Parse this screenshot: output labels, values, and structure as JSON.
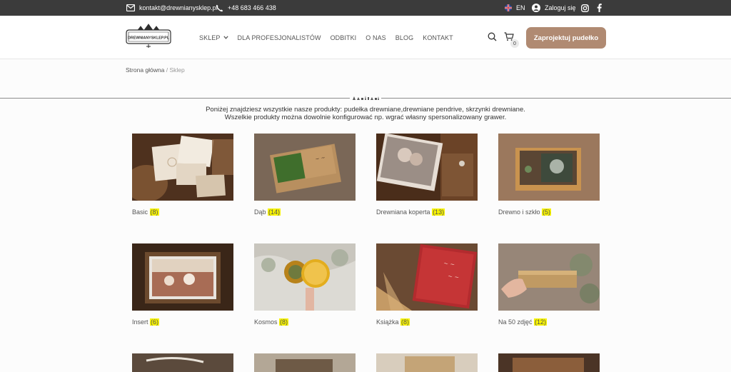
{
  "topbar": {
    "email": "kontakt@drewnianysklep.pl",
    "phone": "+48 683 466 438",
    "language": "EN",
    "login": "Zaloguj się"
  },
  "header": {
    "logo_text": "DREWNIANYSKLEP.PL",
    "nav": [
      {
        "label": "SKLEP",
        "has_dropdown": true
      },
      {
        "label": "DLA PROFESJONALISTÓW"
      },
      {
        "label": "ODBITKI"
      },
      {
        "label": "O NAS"
      },
      {
        "label": "BLOG"
      },
      {
        "label": "KONTAKT"
      }
    ],
    "cart_count": "0",
    "cta_label": "Zaprojektuj pudełko"
  },
  "breadcrumb": {
    "home": "Strona główna",
    "separator": " / ",
    "current": "Sklep"
  },
  "intro": {
    "line1": "Poniżej znajdziesz wszystkie nasze produkty: pudełka drewniane,drewniane pendrive, skrzynki drewniane.",
    "line2": "Wszelkie produkty można dowolnie konfigurować np. wgrać własny spersonalizowany grawer."
  },
  "categories": [
    {
      "name": "Basic",
      "count": "(8)"
    },
    {
      "name": "Dąb",
      "count": "(14)"
    },
    {
      "name": "Drewniana koperta",
      "count": "(13)"
    },
    {
      "name": "Drewno i szkło",
      "count": "(5)"
    },
    {
      "name": "Insert",
      "count": "(6)"
    },
    {
      "name": "Kosmos",
      "count": "(8)"
    },
    {
      "name": "Książka",
      "count": "(8)"
    },
    {
      "name": "Na 50 zdjęć",
      "count": "(12)"
    }
  ],
  "colors": {
    "topbar_bg": "#3b3b3b",
    "cta_bg": "#b08a72",
    "count_highlight": "#f7f300"
  }
}
